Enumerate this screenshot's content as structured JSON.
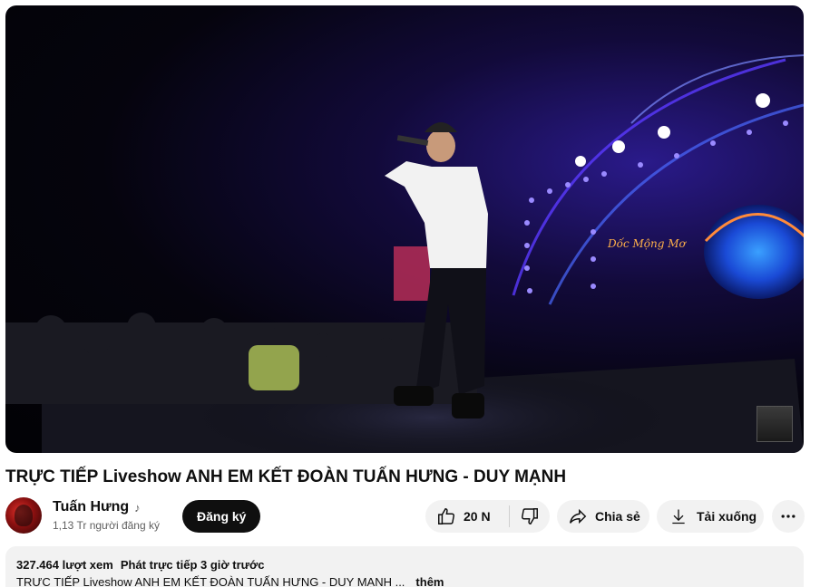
{
  "video": {
    "title": "TRỰC TIẾP Liveshow ANH EM KẾT ĐOÀN TUẤN HƯNG - DUY MẠNH",
    "stage_sign": "Dốc Mộng Mơ"
  },
  "channel": {
    "name": "Tuấn Hưng",
    "badge_icon": "music-note-icon",
    "subscribers": "1,13 Tr người đăng ký",
    "subscribe_label": "Đăng ký"
  },
  "actions": {
    "like_count": "20 N",
    "share_label": "Chia sẻ",
    "download_label": "Tải xuống",
    "icons": [
      "thumbs-up-icon",
      "thumbs-down-icon",
      "share-icon",
      "download-icon",
      "more-icon"
    ]
  },
  "description": {
    "views": "327.464 lượt xem",
    "streamed": "Phát trực tiếp 3 giờ trước",
    "text": "TRỰC TIẾP Liveshow ANH EM KẾT ĐOÀN TUẤN HƯNG - DUY MẠNH ...",
    "more_label": "thêm"
  },
  "colors": {
    "button_bg": "#f2f2f2",
    "subscribe_bg": "#0f0f0f",
    "stage_blue": "#3a2bd6",
    "stage_purple": "#6a2bd6"
  }
}
